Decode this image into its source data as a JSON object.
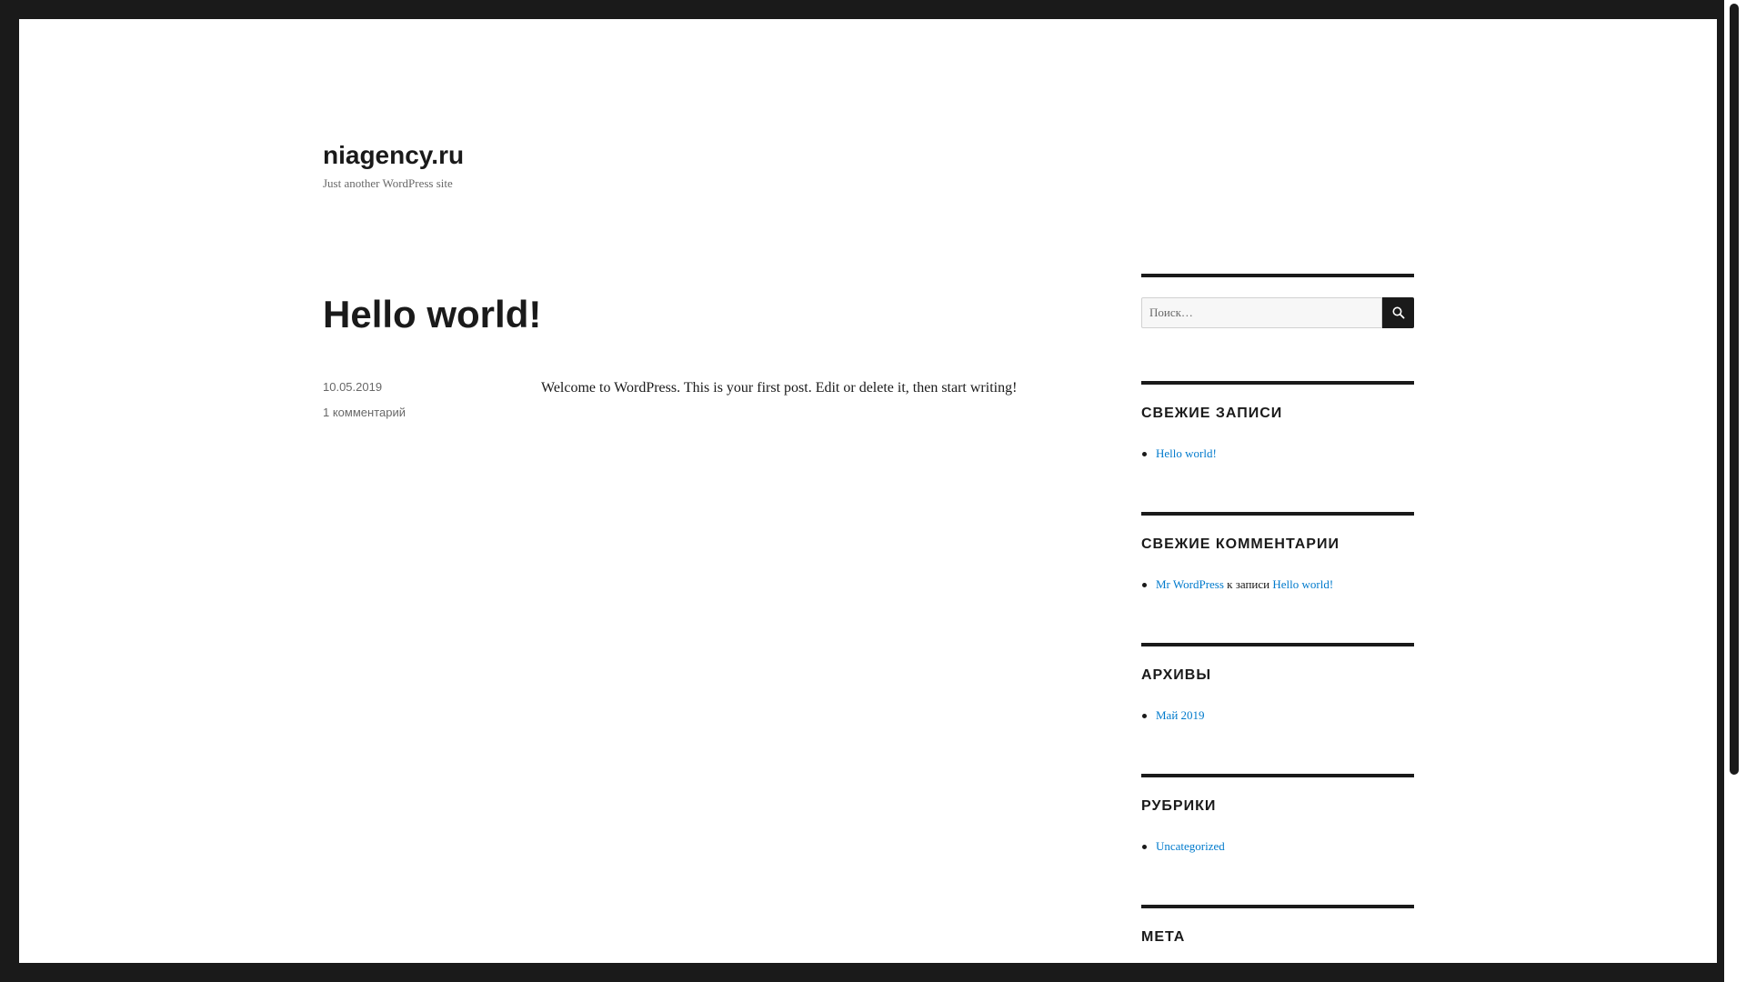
{
  "site": {
    "title": "niagency.ru",
    "description": "Just another WordPress site"
  },
  "post": {
    "title": "Hello world!",
    "date": "10.05.2019",
    "comments": "1 комментарий",
    "content": "Welcome to WordPress. This is your first post. Edit or delete it, then start writing!"
  },
  "sidebar": {
    "search": {
      "placeholder": "Поиск…",
      "button_icon": "search-icon"
    },
    "recent_posts": {
      "title": "СВЕЖИЕ ЗАПИСИ",
      "items": [
        "Hello world!"
      ]
    },
    "recent_comments": {
      "title": "СВЕЖИЕ КОММЕНТАРИИ",
      "items": [
        {
          "author": "Mr WordPress",
          "connector": "к записи",
          "post": "Hello world!"
        }
      ]
    },
    "archives": {
      "title": "АРХИВЫ",
      "items": [
        "Май 2019"
      ]
    },
    "categories": {
      "title": "РУБРИКИ",
      "items": [
        "Uncategorized"
      ]
    },
    "meta": {
      "title": "МЕТА"
    }
  },
  "colors": {
    "link": "#007acc",
    "text": "#1a1a1a",
    "secondary_text": "#686868",
    "frame": "#1a1a1a"
  }
}
